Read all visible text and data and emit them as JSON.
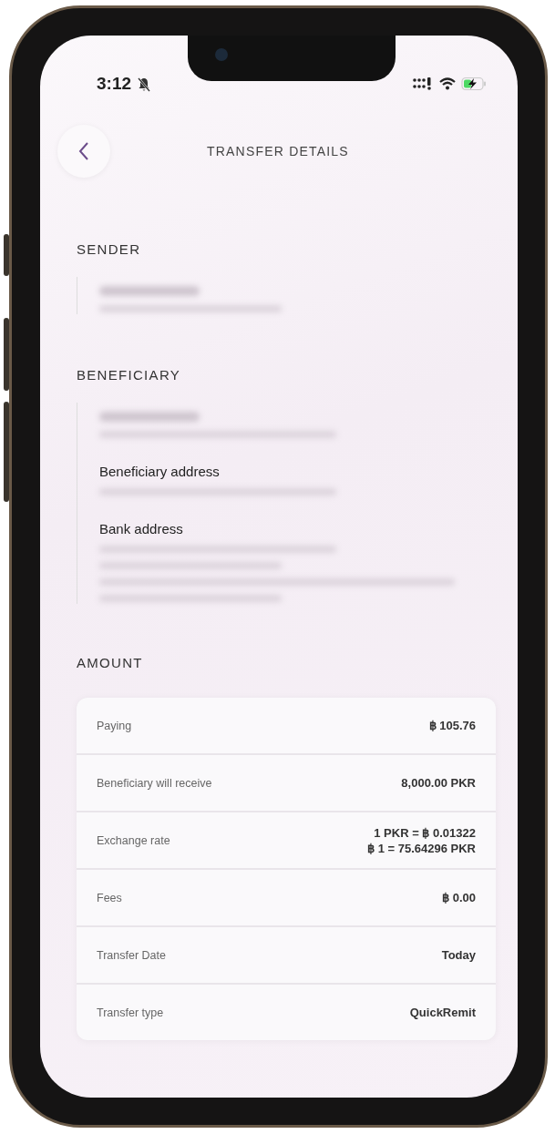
{
  "status_bar": {
    "time": "3:12",
    "silent": true,
    "charging": true
  },
  "header": {
    "title": "TRANSFER DETAILS"
  },
  "sender": {
    "heading": "SENDER"
  },
  "beneficiary": {
    "heading": "BENEFICIARY",
    "subheadings": [
      "Beneficiary address",
      "Bank address"
    ]
  },
  "amount": {
    "heading": "AMOUNT",
    "rows": [
      {
        "label": "Paying",
        "values": [
          "฿ 105.76"
        ]
      },
      {
        "label": "Beneficiary will receive",
        "values": [
          "8,000.00 PKR"
        ]
      },
      {
        "label": "Exchange rate",
        "values": [
          "1 PKR = ฿ 0.01322",
          "฿ 1 = 75.64296 PKR"
        ]
      },
      {
        "label": "Fees",
        "values": [
          "฿ 0.00"
        ]
      },
      {
        "label": "Transfer Date",
        "values": [
          "Today"
        ]
      },
      {
        "label": "Transfer type",
        "values": [
          "QuickRemit"
        ]
      }
    ]
  }
}
